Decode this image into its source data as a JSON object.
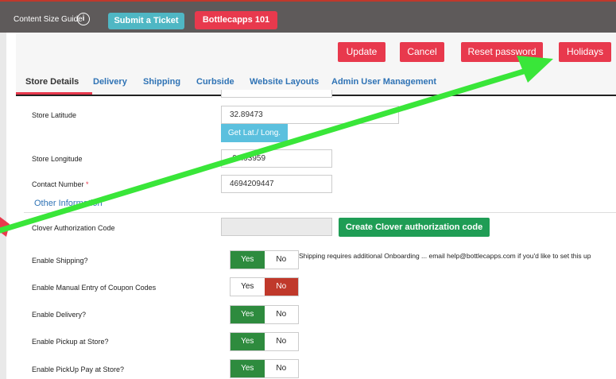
{
  "topbar": {
    "guide_label": "Content Size Guide",
    "info_glyph": "i",
    "ticket_label": "Submit a Ticket",
    "store_label": "Bottlecapps 101"
  },
  "actions": {
    "update": "Update",
    "cancel": "Cancel",
    "reset": "Reset password",
    "holidays": "Holidays"
  },
  "tabs": [
    {
      "label": "Store Details",
      "active": true
    },
    {
      "label": "Delivery"
    },
    {
      "label": "Shipping"
    },
    {
      "label": "Curbside"
    },
    {
      "label": "Website Layouts"
    },
    {
      "label": "Admin User Management"
    }
  ],
  "form": {
    "latitude_label": "Store Latitude",
    "latitude_value": "32.89473",
    "latlong_button": "Get Lat./ Long.",
    "longitude_label": "Store Longitude",
    "longitude_value": "-96.93959",
    "contact_label": "Contact Number",
    "contact_required": "*",
    "contact_value": "4694209447",
    "section_title": "Other Information",
    "clover_label": "Clover Authorization Code",
    "clover_value": "",
    "clover_button": "Create Clover authorization code"
  },
  "toggles": [
    {
      "label": "Enable Shipping?",
      "yes": "Yes",
      "no": "No",
      "value": "Yes"
    },
    {
      "label": "Enable Manual Entry of Coupon Codes",
      "yes": "Yes",
      "no": "No",
      "value": "No"
    },
    {
      "label": "Enable Delivery?",
      "yes": "Yes",
      "no": "No",
      "value": "Yes"
    },
    {
      "label": "Enable Pickup at Store?",
      "yes": "Yes",
      "no": "No",
      "value": "Yes"
    },
    {
      "label": "Enable PickUp Pay at Store?",
      "yes": "Yes",
      "no": "No",
      "value": "Yes"
    }
  ],
  "shipping_note": "Shipping requires additional Onboarding ... email help@bottlecapps.com if you'd like to set this up",
  "colors": {
    "accent_red": "#e8394d",
    "link_blue": "#2f73b5",
    "toggle_yes": "#2e8b3e",
    "toggle_no": "#c0392b",
    "annotation_arrow": "#39e639"
  },
  "annotation": {
    "type": "arrow",
    "points_to": "holidays-button"
  }
}
